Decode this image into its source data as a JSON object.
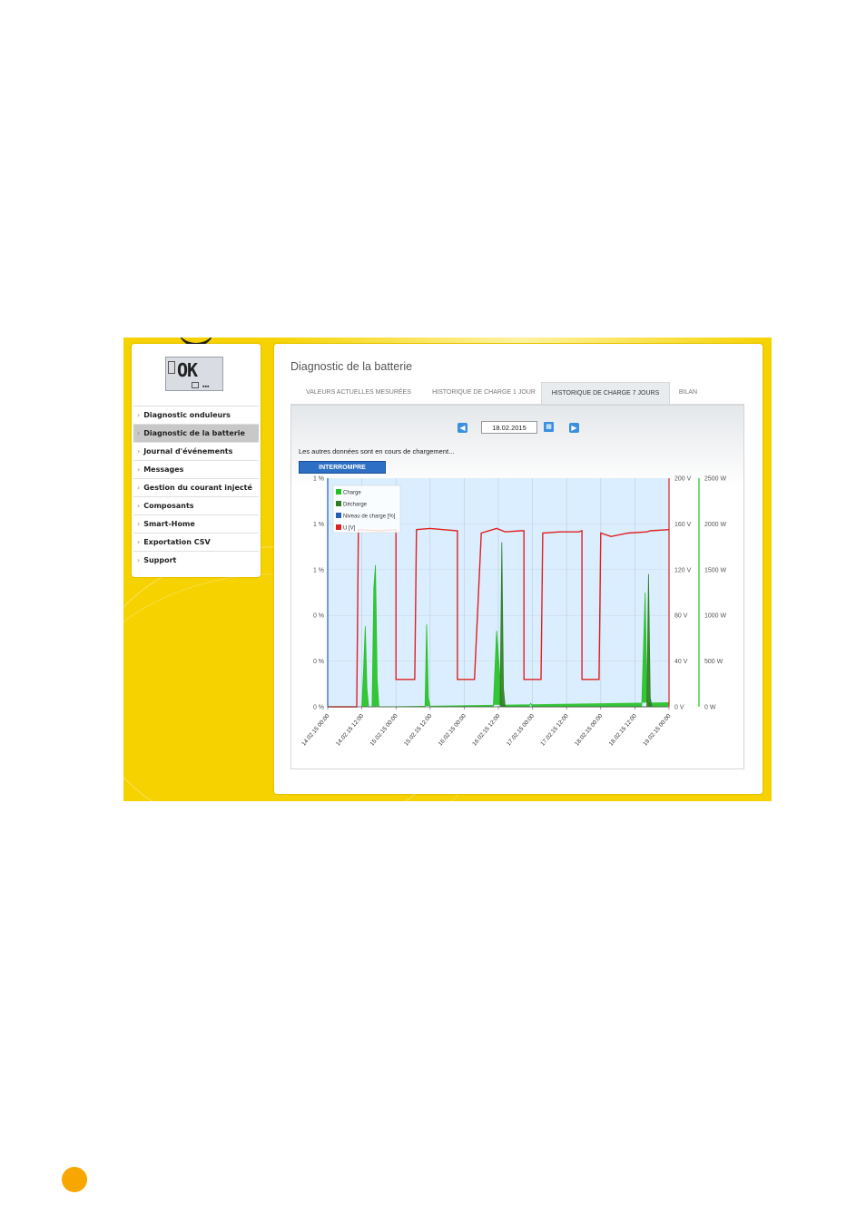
{
  "sidebar": {
    "status_display": "OK",
    "items": [
      {
        "label": "Diagnostic onduleurs",
        "active": false
      },
      {
        "label": "Diagnostic de la batterie",
        "active": true
      },
      {
        "label": "Journal d'événements",
        "active": false
      },
      {
        "label": "Messages",
        "active": false
      },
      {
        "label": "Gestion du courant injecté",
        "active": false
      },
      {
        "label": "Composants",
        "active": false
      },
      {
        "label": "Smart-Home",
        "active": false
      },
      {
        "label": "Exportation CSV",
        "active": false
      },
      {
        "label": "Support",
        "active": false
      }
    ]
  },
  "main": {
    "title": "Diagnostic de la batterie",
    "tabs": [
      {
        "label": "VALEURS ACTUELLES MESURÉES",
        "active": false
      },
      {
        "label": "HISTORIQUE DE CHARGE 1 JOUR",
        "active": false
      },
      {
        "label": "HISTORIQUE DE CHARGE 7 JOURS",
        "active": true
      },
      {
        "label": "BILAN",
        "active": false
      }
    ],
    "date_value": "18.02.2015",
    "loading_message": "Les autres données sont en cours de chargement...",
    "stop_button": "INTERROMPRE"
  },
  "colors": {
    "accent": "#f6d200",
    "blue": "#2d6fc4",
    "charge": "#22c122",
    "discharge": "#2e7d1f",
    "level": "#1f5fb8",
    "voltage": "#e02020"
  },
  "chart_data": {
    "type": "line",
    "x_ticks": [
      "14.02.15 00:00",
      "14.02.15 12:00",
      "15.02.15 00:00",
      "15.02.15 12:00",
      "16.02.15 00:00",
      "16.02.15 12:00",
      "17.02.15 00:00",
      "17.02.15 12:00",
      "18.02.15 00:00",
      "18.02.15 12:00",
      "19.02.15 00:00"
    ],
    "left_axis": {
      "ticks": [
        "1 %",
        "1 %",
        "1 %",
        "0 %",
        "0 %",
        "0 %"
      ]
    },
    "voltage_axis": {
      "ticks": [
        "0 V",
        "40 V",
        "80 V",
        "120 V",
        "160 V",
        "200 V"
      ],
      "ylim": [
        0,
        200
      ]
    },
    "power_axis": {
      "ticks": [
        "0 W",
        "500 W",
        "1000 W",
        "1500 W",
        "2000 W",
        "2500 W"
      ],
      "ylim": [
        0,
        2500
      ]
    },
    "legend": [
      "Charge",
      "Décharge",
      "Niveau de charge [%]",
      "U [V]"
    ],
    "voltage_series": [
      [
        0.0,
        0
      ],
      [
        0.85,
        0
      ],
      [
        0.9,
        155
      ],
      [
        1.5,
        154
      ],
      [
        2.0,
        155
      ],
      [
        2.0,
        24
      ],
      [
        2.55,
        24
      ],
      [
        2.6,
        155
      ],
      [
        3.0,
        156
      ],
      [
        3.8,
        154
      ],
      [
        3.8,
        24
      ],
      [
        4.3,
        24
      ],
      [
        4.5,
        152
      ],
      [
        4.95,
        156
      ],
      [
        5.2,
        153
      ],
      [
        5.65,
        154
      ],
      [
        5.75,
        154
      ],
      [
        5.75,
        24
      ],
      [
        6.25,
        24
      ],
      [
        6.3,
        152
      ],
      [
        6.8,
        153
      ],
      [
        7.35,
        153
      ],
      [
        7.45,
        154
      ],
      [
        7.45,
        24
      ],
      [
        7.95,
        24
      ],
      [
        8.0,
        152
      ],
      [
        8.3,
        149
      ],
      [
        8.8,
        152
      ],
      [
        9.35,
        153
      ],
      [
        9.45,
        154
      ],
      [
        10.0,
        155
      ]
    ],
    "charge_series_W": [
      [
        1.0,
        0
      ],
      [
        1.05,
        400
      ],
      [
        1.1,
        880
      ],
      [
        1.15,
        200
      ],
      [
        1.2,
        0
      ],
      [
        1.3,
        0
      ],
      [
        1.35,
        1300
      ],
      [
        1.4,
        1550
      ],
      [
        1.45,
        300
      ],
      [
        1.5,
        0
      ],
      [
        2.85,
        0
      ],
      [
        2.9,
        900
      ],
      [
        2.95,
        100
      ],
      [
        3.0,
        0
      ],
      [
        4.85,
        0
      ],
      [
        4.95,
        830
      ],
      [
        5.05,
        300
      ],
      [
        5.1,
        0
      ],
      [
        5.9,
        0
      ],
      [
        5.95,
        40
      ],
      [
        6.0,
        0
      ],
      [
        9.2,
        0
      ],
      [
        9.3,
        1250
      ],
      [
        9.35,
        150
      ],
      [
        9.4,
        0
      ],
      [
        9.95,
        0
      ],
      [
        10.0,
        50
      ]
    ],
    "discharge_series_W": [
      [
        5.05,
        0
      ],
      [
        5.1,
        1800
      ],
      [
        5.15,
        200
      ],
      [
        5.2,
        0
      ],
      [
        9.35,
        0
      ],
      [
        9.4,
        1450
      ],
      [
        9.45,
        100
      ],
      [
        9.5,
        0
      ]
    ]
  }
}
